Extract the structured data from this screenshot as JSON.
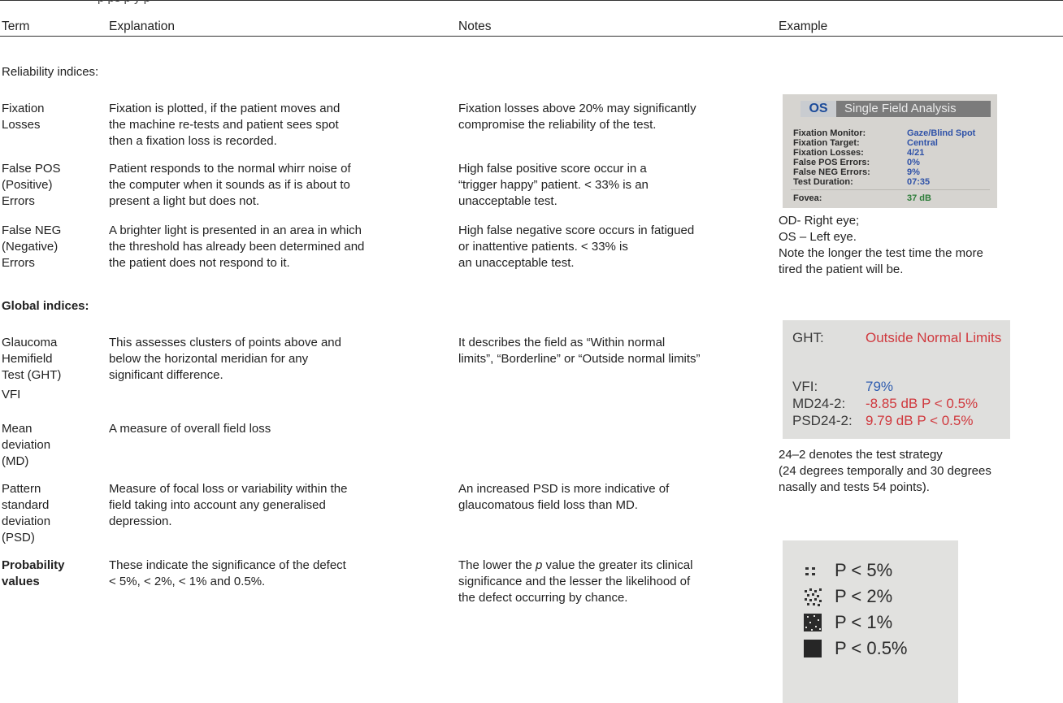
{
  "header": {
    "caption_fragment": "p   ps   p   y   p",
    "term": "Term",
    "explanation": "Explanation",
    "notes": "Notes",
    "example": "Example"
  },
  "sections": {
    "reliability": "Reliability indices:",
    "global": "Global indices:"
  },
  "rows": {
    "fixation": {
      "term": [
        "Fixation",
        "Losses"
      ],
      "explanation": [
        "Fixation is plotted, if the patient moves and",
        "the machine re-tests and patient sees spot",
        "then a fixation loss is recorded."
      ],
      "notes": [
        "Fixation losses above 20% may significantly",
        "compromise the reliability of the test."
      ]
    },
    "falsepos": {
      "term": [
        "False POS",
        "(Positive)",
        "Errors"
      ],
      "explanation": [
        "Patient responds to the normal whirr noise of",
        "the computer when it sounds as if is about to",
        "present a light but does not."
      ],
      "notes": [
        "High false positive score occur in a",
        "“trigger happy” patient. < 33% is an",
        "unacceptable test."
      ]
    },
    "falseneg": {
      "term": [
        "False NEG",
        "(Negative)",
        "Errors"
      ],
      "explanation": [
        "A brighter light is presented in an area in which",
        "the threshold has already been determined and",
        "the patient does not respond to it."
      ],
      "notes": [
        "High false negative score occurs in fatigued",
        "or inattentive patients. < 33% is",
        "an unacceptable test."
      ]
    },
    "ght": {
      "term": [
        "Glaucoma",
        "Hemifield",
        "Test (GHT)"
      ],
      "explanation": [
        "This assesses clusters of points above and",
        "below the horizontal meridian for any",
        "significant difference."
      ],
      "notes": [
        "It describes the field as “Within normal",
        "limits”, “Borderline” or “Outside normal limits”"
      ]
    },
    "vfi": {
      "term": [
        "VFI"
      ]
    },
    "md": {
      "term": [
        "Mean",
        "deviation",
        "(MD)"
      ],
      "explanation": [
        "A measure of overall field loss"
      ]
    },
    "psd": {
      "term": [
        "Pattern",
        "standard",
        "deviation",
        "(PSD)"
      ],
      "explanation": [
        "Measure of focal loss or variability within the",
        "field taking into account any generalised",
        "depression."
      ],
      "notes": [
        "An increased PSD is more indicative of",
        "glaucomatous field loss than MD."
      ]
    },
    "prob": {
      "term": [
        "Probability",
        "values"
      ],
      "explanation": [
        "These indicate the significance of the defect",
        "< 5%, < 2%, < 1% and 0.5%."
      ],
      "notes_line1_pre": "The lower the ",
      "notes_line1_italic": "p",
      "notes_line1_post": " value the greater its clinical",
      "notes": [
        "significance and the lesser the likelihood of",
        "the defect occurring by chance."
      ]
    }
  },
  "example_text": {
    "reliability": [
      "OD- Right eye;",
      "OS – Left eye.",
      "Note the longer the test time the more",
      "tired the patient will be."
    ],
    "global": [
      "24–2 denotes the test strategy",
      "(24 degrees temporally and 30 degrees",
      "nasally and tests 54 points)."
    ]
  },
  "photo1": {
    "eye": "OS",
    "title": "Single Field Analysis",
    "rows": [
      {
        "label": "Fixation Monitor:",
        "value": "Gaze/Blind Spot"
      },
      {
        "label": "Fixation Target:",
        "value": "Central"
      },
      {
        "label": "Fixation Losses:",
        "value": "4/21"
      },
      {
        "label": "False POS Errors:",
        "value": "0%"
      },
      {
        "label": "False NEG Errors:",
        "value": "9%"
      },
      {
        "label": "Test Duration:",
        "value": "07:35"
      },
      {
        "label": "Fovea:",
        "value": "37 dB"
      }
    ]
  },
  "photo2": {
    "ght_label": "GHT:",
    "ght_value": "Outside Normal Limits",
    "vfi_label": "VFI:",
    "vfi_value": "79%",
    "md_label": "MD24-2:",
    "md_value": "-8.85 dB P < 0.5%",
    "psd_label": "PSD24-2:",
    "psd_value": "9.79 dB P < 0.5%",
    "colors": {
      "red": "#d0393e",
      "blue": "#2f5db0"
    }
  },
  "photo3": {
    "items": [
      "P < 5%",
      "P < 2%",
      "P < 1%",
      "P < 0.5%"
    ],
    "symbols": [
      "dots-sparse-icon",
      "dots-medium-icon",
      "dots-dense-icon",
      "solid-square-icon"
    ]
  }
}
